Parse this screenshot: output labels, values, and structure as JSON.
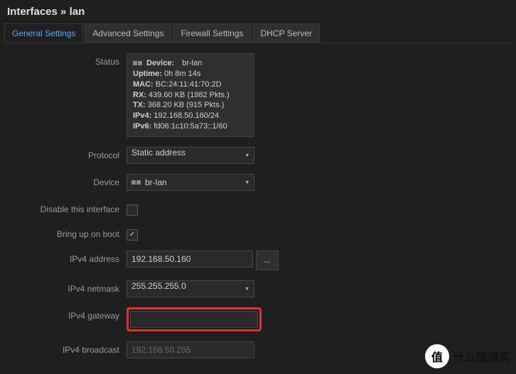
{
  "title_prefix": "Interfaces",
  "title_separator": " » ",
  "title_iface": "lan",
  "tabs": [
    {
      "label": "General Settings",
      "active": true
    },
    {
      "label": "Advanced Settings",
      "active": false
    },
    {
      "label": "Firewall Settings",
      "active": false
    },
    {
      "label": "DHCP Server",
      "active": false
    }
  ],
  "labels": {
    "status": "Status",
    "protocol": "Protocol",
    "device": "Device",
    "disable": "Disable this interface",
    "bringup": "Bring up on boot",
    "ipv4_addr": "IPv4 address",
    "ipv4_netmask": "IPv4 netmask",
    "ipv4_gateway": "IPv4 gateway",
    "ipv4_broadcast": "IPv4 broadcast"
  },
  "status": {
    "device_label": "Device:",
    "device_value": "br-lan",
    "uptime_label": "Uptime:",
    "uptime_value": "0h 8m 14s",
    "mac_label": "MAC:",
    "mac_value": "BC:24:11:41:70:2D",
    "rx_label": "RX:",
    "rx_value": "439.60 KB (1982 Pkts.)",
    "tx_label": "TX:",
    "tx_value": "368.20 KB (915 Pkts.)",
    "ipv4_label": "IPv4:",
    "ipv4_value": "192.168.50.160/24",
    "ipv6_label": "IPv6:",
    "ipv6_value": "fd06:1c10:5a73::1/60"
  },
  "values": {
    "protocol": "Static address",
    "device": "br-lan",
    "disable_checked": false,
    "bringup_checked": true,
    "ipv4_addr": "192.168.50.160",
    "ipv4_addr_addon": "...",
    "ipv4_netmask": "255.255.255.0",
    "ipv4_gateway": "",
    "ipv4_broadcast_placeholder": "192.168.50.255"
  },
  "watermark": {
    "circle": "值",
    "text": "什么值得买"
  }
}
